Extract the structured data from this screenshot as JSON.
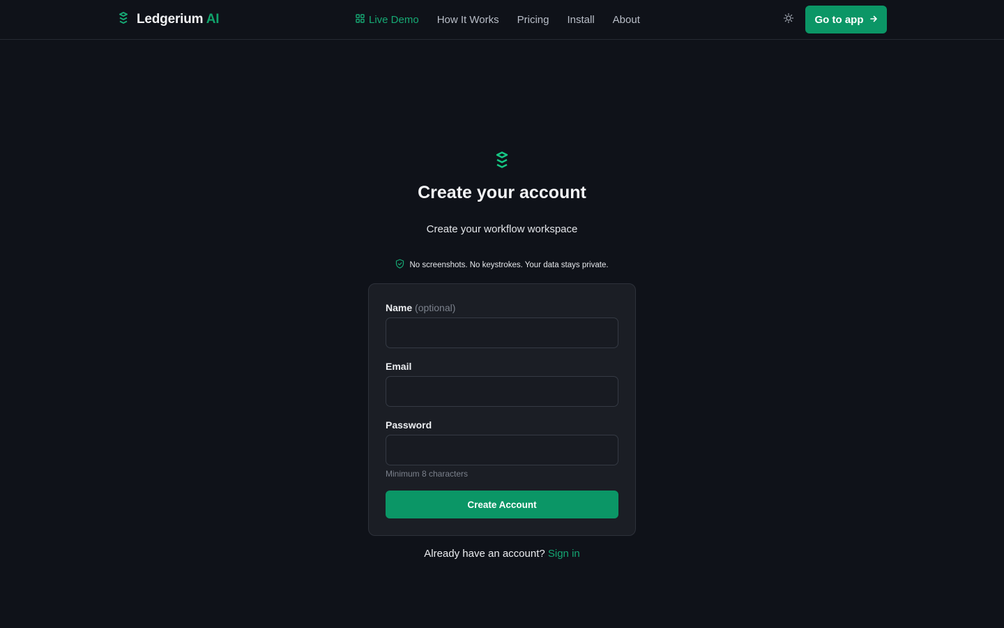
{
  "header": {
    "brand_name": "Ledgerium",
    "brand_suffix": "AI",
    "nav": [
      {
        "label": "Live Demo",
        "icon": "grid-icon",
        "active": true
      },
      {
        "label": "How It Works"
      },
      {
        "label": "Pricing"
      },
      {
        "label": "Install"
      },
      {
        "label": "About"
      }
    ],
    "theme_icon": "sun-icon",
    "cta_label": "Go to app",
    "cta_icon": "arrow-right-icon"
  },
  "main": {
    "logo_icon": "layers-icon",
    "title": "Create your account",
    "subtitle": "Create your workflow workspace",
    "privacy_icon": "shield-check-icon",
    "privacy_text": "No screenshots. No keystrokes. Your data stays private."
  },
  "form": {
    "name_label": "Name",
    "name_optional": "(optional)",
    "name_value": "",
    "email_label": "Email",
    "email_value": "",
    "password_label": "Password",
    "password_value": "",
    "password_hint": "Minimum 8 characters",
    "submit_label": "Create Account"
  },
  "footer": {
    "signin_prompt": "Already have an account?",
    "signin_link": "Sign in"
  },
  "colors": {
    "background": "#0f1219",
    "accent": "#0b9666",
    "accent_text": "#16a974",
    "card": "#1b1e25"
  }
}
